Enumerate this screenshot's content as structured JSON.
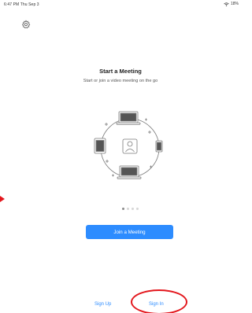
{
  "status_bar": {
    "time_date": "6:47 PM   Thu Sep 3",
    "battery": "18%"
  },
  "settings": {
    "icon": "gear-icon"
  },
  "onboarding": {
    "title": "Start a Meeting",
    "subtitle": "Start or join a video meeting on the go",
    "page_count": 4,
    "active_page": 1
  },
  "actions": {
    "join_label": "Join a Meeting",
    "signup_label": "Sign Up",
    "signin_label": "Sign In"
  },
  "colors": {
    "accent": "#2d8cff",
    "annotation": "#e3171d",
    "illustration_stroke": "#7a7a7a"
  }
}
